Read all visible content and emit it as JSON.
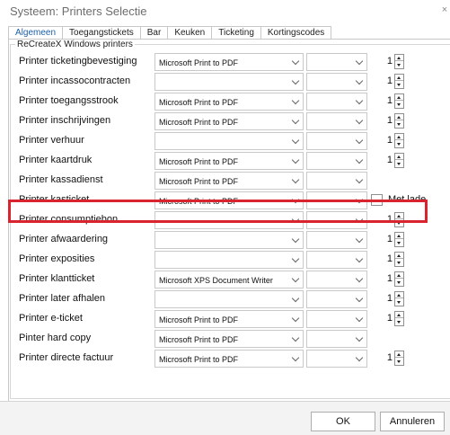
{
  "window": {
    "title": "Systeem: Printers Selectie",
    "close_glyph": "×"
  },
  "tabs": [
    {
      "label": "Algemeen",
      "active": true
    },
    {
      "label": "Toegangstickets",
      "active": false
    },
    {
      "label": "Bar",
      "active": false
    },
    {
      "label": "Keuken",
      "active": false
    },
    {
      "label": "Ticketing",
      "active": false
    },
    {
      "label": "Kortingscodes",
      "active": false
    }
  ],
  "group": {
    "label": "ReCreateX Windows printers"
  },
  "rows": [
    {
      "label": "Printer ticketingbevestiging",
      "printer": "Microsoft Print to PDF",
      "tray": "",
      "copies": "1"
    },
    {
      "label": "Printer incassocontracten",
      "printer": "",
      "tray": "",
      "copies": "1"
    },
    {
      "label": "Printer toegangsstrook",
      "printer": "Microsoft Print to PDF",
      "tray": "",
      "copies": "1"
    },
    {
      "label": "Printer inschrijvingen",
      "printer": "Microsoft Print to PDF",
      "tray": "",
      "copies": "1"
    },
    {
      "label": "Printer verhuur",
      "printer": "",
      "tray": "",
      "copies": "1"
    },
    {
      "label": "Printer kaartdruk",
      "printer": "Microsoft Print to PDF",
      "tray": "",
      "copies": "1"
    },
    {
      "label": "Printer kassadienst",
      "printer": "Microsoft Print to PDF",
      "tray": ""
    },
    {
      "label": "Printer kasticket",
      "printer": "Microsoft Print to PDF",
      "tray": "",
      "checkbox_label": "Met lade",
      "checked": false
    },
    {
      "label": "Printer consumptiebon",
      "printer": "",
      "tray": "",
      "copies": "1"
    },
    {
      "label": "Printer afwaardering",
      "printer": "",
      "tray": "",
      "copies": "1"
    },
    {
      "label": "Printer exposities",
      "printer": "",
      "tray": "",
      "copies": "1"
    },
    {
      "label": "Printer klantticket",
      "printer": "Microsoft XPS Document Writer",
      "tray": "",
      "copies": "1"
    },
    {
      "label": "Printer later afhalen",
      "printer": "",
      "tray": "",
      "copies": "1"
    },
    {
      "label": "Printer e-ticket",
      "printer": "Microsoft Print to PDF",
      "tray": "",
      "copies": "1"
    },
    {
      "label": "Pinter hard copy",
      "printer": "Microsoft Print to PDF",
      "tray": ""
    },
    {
      "label": "Printer directe factuur",
      "printer": "Microsoft Print to PDF",
      "tray": "",
      "copies": "1"
    }
  ],
  "footer": {
    "ok_label": "OK",
    "cancel_label": "Annuleren"
  },
  "colors": {
    "highlight": "#d9232e",
    "active_tab": "#1c5fa8"
  }
}
